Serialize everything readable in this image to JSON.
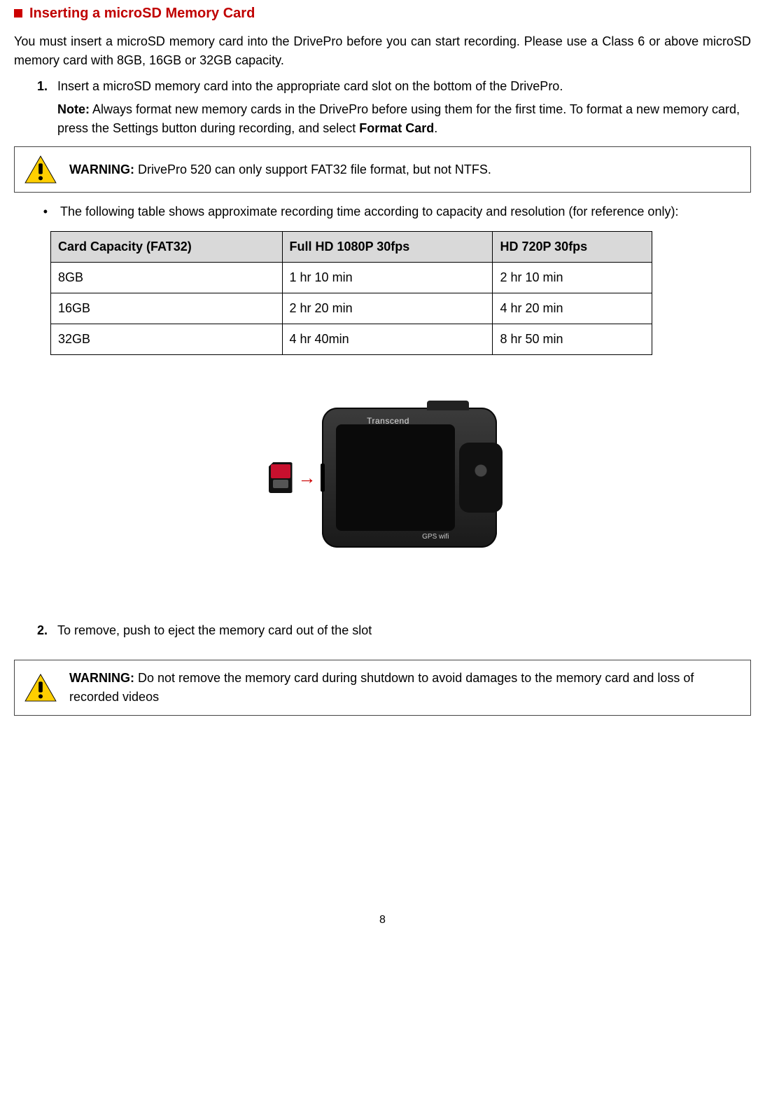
{
  "heading": "Inserting a microSD Memory Card",
  "intro": "You must insert a microSD memory card into the DrivePro before you can start recording. Please use a Class 6 or above microSD memory card with 8GB, 16GB or 32GB capacity.",
  "step1_num": "1.",
  "step1_text": "Insert a microSD memory card into the appropriate card slot on the bottom of the DrivePro.",
  "note_label": "Note:",
  "note_text": " Always format new memory cards in the DrivePro before using them for the first time. To format a new memory card, press the Settings button during recording, and select ",
  "note_bold_tail": "Format Card",
  "note_period": ".",
  "warn1_label": "WARNING:",
  "warn1_text": " DrivePro 520 can only support FAT32 file format, but not NTFS.",
  "bullet_text": "The following table shows approximate recording time according to capacity and resolution (for reference only):",
  "table": {
    "headers": [
      "Card Capacity (FAT32)",
      "Full HD 1080P 30fps",
      "HD 720P 30fps"
    ],
    "rows": [
      [
        "8GB",
        "1 hr 10 min",
        "2 hr 10 min"
      ],
      [
        "16GB",
        "2 hr 20 min",
        "4 hr 20 min"
      ],
      [
        "32GB",
        "4 hr 40min",
        "8 hr 50 min"
      ]
    ]
  },
  "device_brand": "Transcend",
  "device_badge": "GPS wifi",
  "step2_num": "2.",
  "step2_text": "To remove, push to eject the memory card out of the slot",
  "warn2_label": "WARNING:",
  "warn2_text": " Do not remove the memory card during shutdown to avoid damages to the memory card and loss of recorded videos",
  "page_number": "8"
}
